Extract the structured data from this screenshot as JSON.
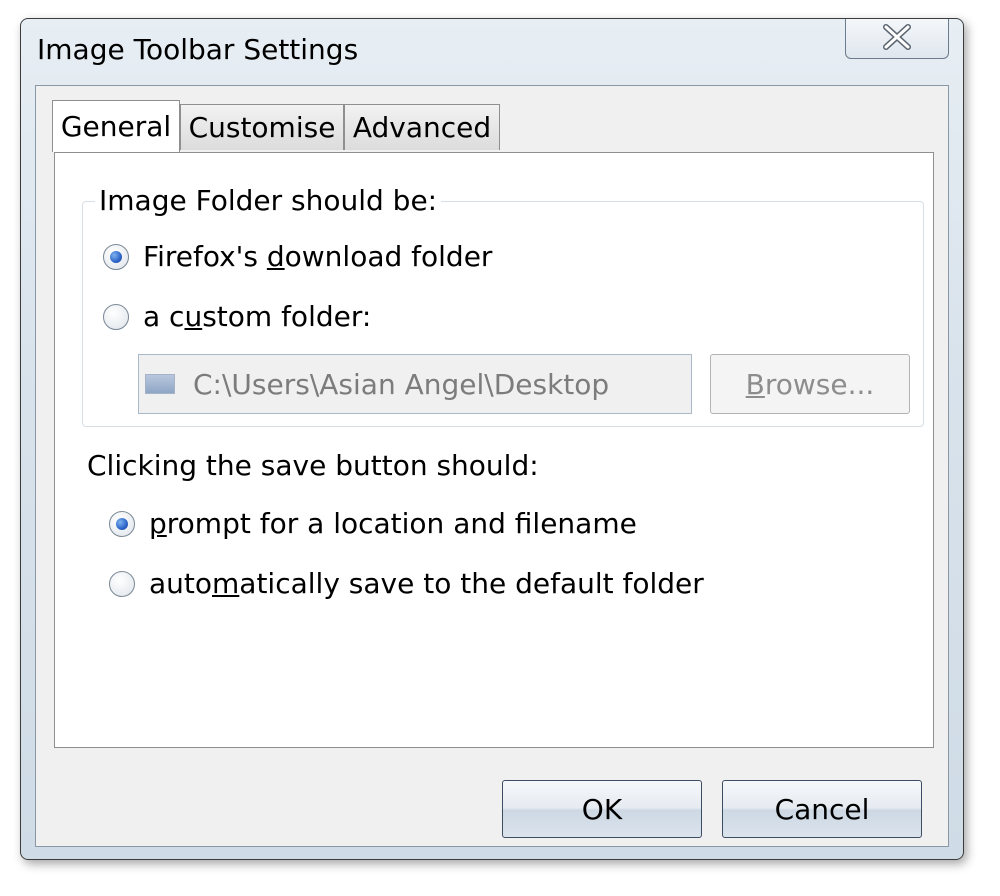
{
  "window": {
    "title": "Image Toolbar Settings"
  },
  "tabs": [
    {
      "label": "General",
      "active": true
    },
    {
      "label": "Customise",
      "active": false
    },
    {
      "label": "Advanced",
      "active": false
    }
  ],
  "folder_group": {
    "legend": "Image Folder should be:",
    "option_download": {
      "pre": "Firefox's ",
      "ul": "d",
      "post": "ownload folder",
      "checked": true
    },
    "option_custom": {
      "pre": "a c",
      "ul": "u",
      "post": "stom folder:",
      "checked": false
    },
    "path_value": "C:\\Users\\Asian Angel\\Desktop",
    "browse": {
      "ul": "B",
      "post": "rowse..."
    }
  },
  "save_group": {
    "label": "Clicking the save button should:",
    "option_prompt": {
      "pre": "",
      "ul": "p",
      "post": "rompt for a location and filename",
      "checked": true
    },
    "option_auto": {
      "pre": "auto",
      "ul": "m",
      "post": "atically save to the default folder",
      "checked": false
    }
  },
  "buttons": {
    "ok": "OK",
    "cancel": "Cancel"
  },
  "icons": {
    "close": "close-icon",
    "folder": "folder-icon"
  },
  "colors": {
    "radio_checked": "#2c64c8",
    "frame": "#d9e3ec"
  }
}
